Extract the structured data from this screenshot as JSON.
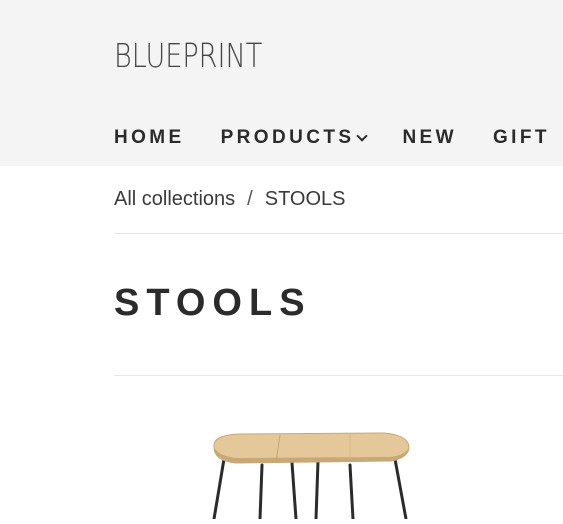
{
  "header": {
    "logo": "BLUEPRINT",
    "nav": [
      {
        "label": "HOME"
      },
      {
        "label": "PRODUCTS",
        "icon": "chevron-down-icon"
      },
      {
        "label": "NEW"
      },
      {
        "label": "GIFT"
      }
    ]
  },
  "breadcrumb": {
    "root": "All collections",
    "separator": "/",
    "current": "STOOLS"
  },
  "page": {
    "title": "STOOLS"
  },
  "products": [
    {
      "image": "stool-product-image"
    }
  ],
  "colors": {
    "header_bg": "#f4f4f4",
    "text": "#2b2b2b",
    "stool_seat": "#e4c89a",
    "stool_legs": "#2b2b2b"
  }
}
